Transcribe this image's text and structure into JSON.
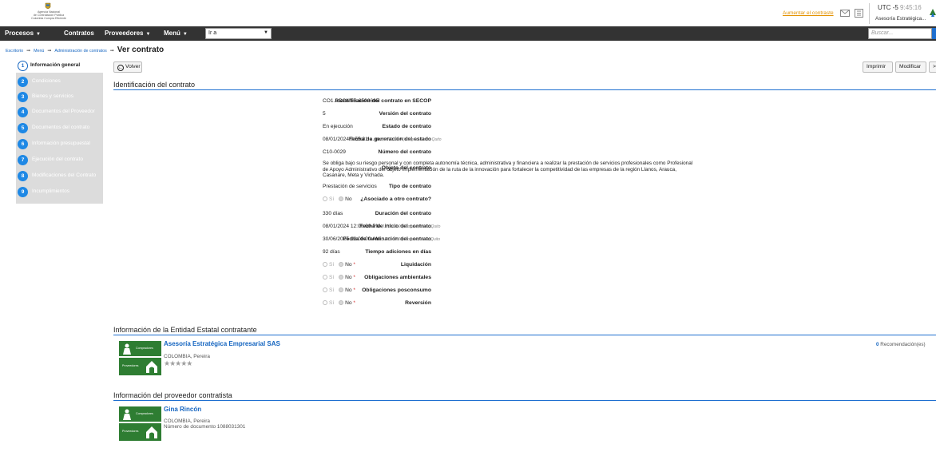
{
  "header": {
    "logo_lines": [
      "Agencia Nacional",
      "de Contratación Pública",
      "Colombia Compra Eficiente"
    ],
    "account_link": "Aumentar el contraste",
    "utc_label": "UTC -5",
    "utc_time": "9:45:16",
    "organization": "Asesoría Estratégica..."
  },
  "nav": {
    "items": [
      "Procesos",
      "Contratos",
      "Proveedores",
      "Menú"
    ],
    "goto_value": "Ir a",
    "search_placeholder": "Buscar..."
  },
  "breadcrumb": {
    "links": [
      "Escritorio",
      "Menú",
      "Administración de contratos"
    ],
    "current": "Ver contrato"
  },
  "steps": [
    {
      "n": "1",
      "label": "Información general"
    },
    {
      "n": "2",
      "label": "Condiciones"
    },
    {
      "n": "3",
      "label": "Bienes y servicios"
    },
    {
      "n": "4",
      "label": "Documentos del Proveedor"
    },
    {
      "n": "5",
      "label": "Documentos del contrato"
    },
    {
      "n": "6",
      "label": "Información presupuestal"
    },
    {
      "n": "7",
      "label": "Ejecución del contrato"
    },
    {
      "n": "8",
      "label": "Modificaciones del Contrato"
    },
    {
      "n": "9",
      "label": "Incumplimientos"
    }
  ],
  "buttons": {
    "back": "Volver",
    "print": "Imprimir",
    "modify": "Modificar",
    "more": ">"
  },
  "contract": {
    "section_title": "Identificación del contrato",
    "fields": [
      {
        "label": "Identificación del contrato en SECOP",
        "value": "CO1.PCCNTR.6592695"
      },
      {
        "label": "Versión del contrato",
        "value": "5"
      },
      {
        "label": "Estado de contrato",
        "value": "En ejecución"
      },
      {
        "label": "Fecha de generación del estado",
        "value": "08/01/2024 9:55:01 a. m.",
        "tz": "(UTC-05:00) Bogotá, Lima, Quito"
      },
      {
        "label": "Número del contrato",
        "value": "C10-0029"
      },
      {
        "label": "Objeto del contrato",
        "value": "Se obliga bajo su riesgo personal y con completa autonomía técnica, administrativa y financiera a realizar la prestación de servicios profesionales como Profesional de Apoyo Administrativo del objeto Implementación de la ruta de la innovación para fortalecer la competitividad de las empresas de la región Llanos, Arauca, Casanare, Meta y Vichada."
      },
      {
        "label": "Tipo de contrato",
        "value": "Prestación de servicios"
      },
      {
        "label": "¿Asociado a otro contrato?",
        "yes": "Sí",
        "no": "No"
      },
      {
        "label": "Duración del contrato",
        "value": "330  días"
      },
      {
        "label": "Fecha de inicio del contrato",
        "value": "08/01/2024 12:00:00 PM",
        "tz": "(UTC-05:00) Bogotá, Lima, Quito"
      },
      {
        "label": "Fecha de terminación del contrato",
        "value": "30/06/2025 12:00:00 AM",
        "tz": "(UTC-05:00) Bogotá, Lima, Quito"
      },
      {
        "label": "Tiempo adiciones en días",
        "value": "92 días"
      },
      {
        "label": "Liquidación",
        "yes": "Sí",
        "no": "No",
        "req": "*"
      },
      {
        "label": "Obligaciones ambientales",
        "yes": "Sí",
        "no": "No",
        "req": "*"
      },
      {
        "label": "Obligaciones posconsumo",
        "yes": "Sí",
        "no": "No",
        "req": "*"
      },
      {
        "label": "Reversión",
        "yes": "Sí",
        "no": "No",
        "req": "*"
      }
    ]
  },
  "entity": {
    "section_title": "Información de la Entidad Estatal contratante",
    "name": "Asesoría Estratégica Empresarial SAS",
    "location": "COLOMBIA, Pereira",
    "stars": "★★★★★",
    "recommendations_count": "0",
    "recommendations_label": "Recomendación(es)",
    "logo_top": "Compradores",
    "logo_bottom": "Proveedores"
  },
  "supplier": {
    "section_title": "Información del proveedor contratista",
    "name": "Gina Rincón",
    "location": "COLOMBIA, Pereira",
    "document": "Número de documento 1088031301",
    "logo_top": "Compradores",
    "logo_bottom": "Proveedores"
  }
}
